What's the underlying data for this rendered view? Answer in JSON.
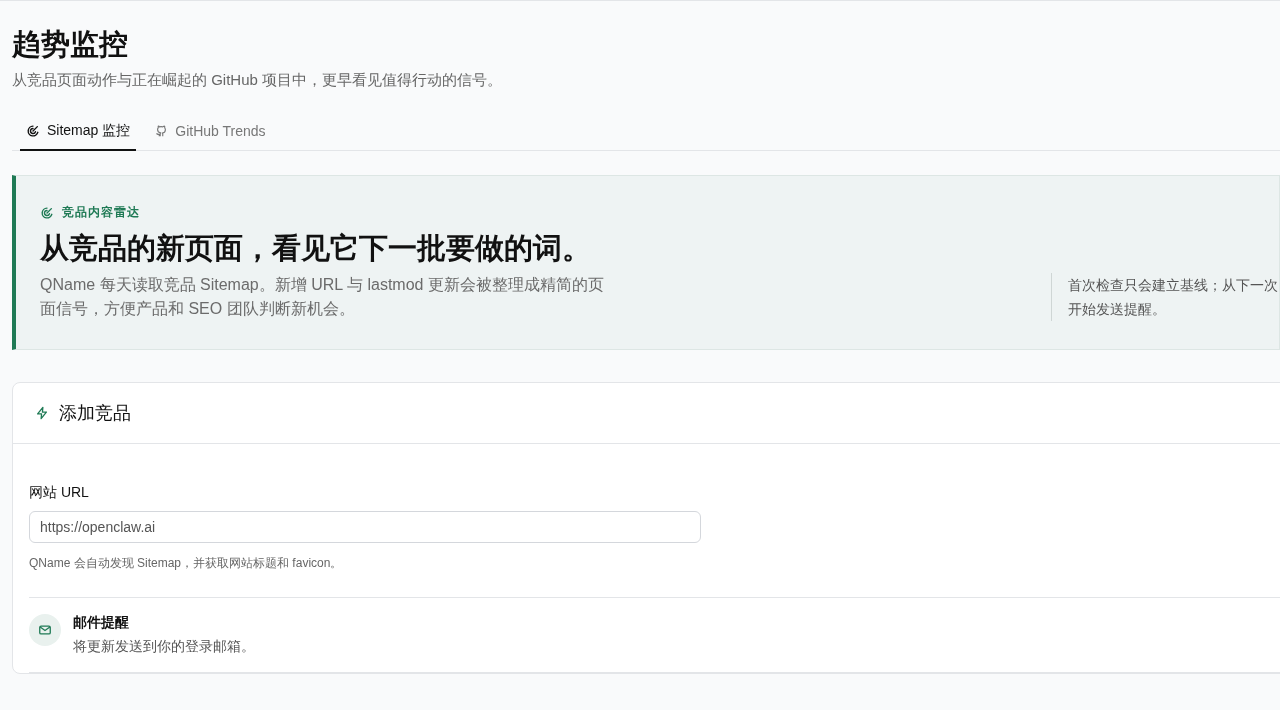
{
  "page": {
    "title": "趋势监控",
    "subtitle": "从竞品页面动作与正在崛起的 GitHub 项目中，更早看见值得行动的信号。"
  },
  "tabs": [
    {
      "label": "Sitemap 监控",
      "kind": "radar",
      "selected": true
    },
    {
      "label": "GitHub Trends",
      "kind": "github",
      "selected": false
    }
  ],
  "hero": {
    "eyebrow": "竞品内容雷达",
    "headline": "从竞品的新页面，看见它下一批要做的词。",
    "description": "QName 每天读取竞品 Sitemap。新增 URL 与 lastmod 更新会被整理成精简的页面信号，方便产品和 SEO 团队判断新机会。",
    "note": "首次检查只会建立基线；从下一次开始发送提醒。"
  },
  "add_card": {
    "title": "添加竞品",
    "url_label": "网站 URL",
    "url_placeholder": "https://openclaw.ai",
    "url_help": "QName 会自动发现 Sitemap，并获取网站标题和 favicon。",
    "email_title": "邮件提醒",
    "email_description": "将更新发送到你的登录邮箱。"
  }
}
